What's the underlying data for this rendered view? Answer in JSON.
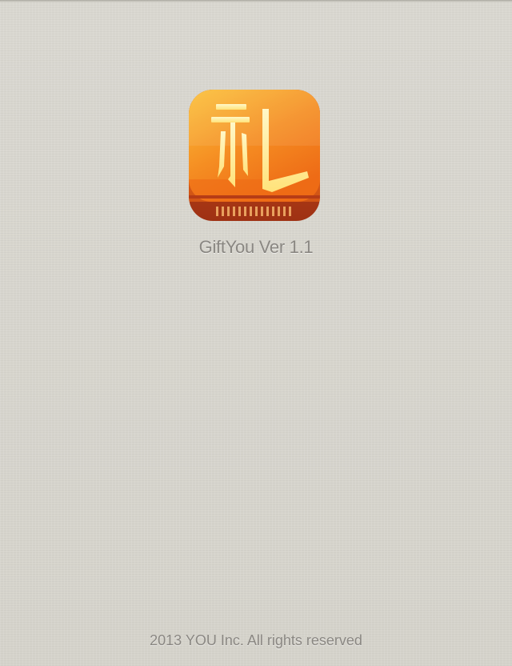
{
  "splash": {
    "app_icon": {
      "name": "gift-app-icon",
      "glyph": "礼",
      "colors": {
        "top": "#f9b531",
        "bottom": "#ef6a16",
        "base": "#c8411a",
        "glyph": "#fff3b0"
      }
    },
    "version_text": "GiftYou Ver 1.1",
    "copyright_text": "2013 YOU Inc. All rights reserved"
  },
  "theme": {
    "background": "#d8d6cf",
    "text_color": "#8a8782"
  }
}
